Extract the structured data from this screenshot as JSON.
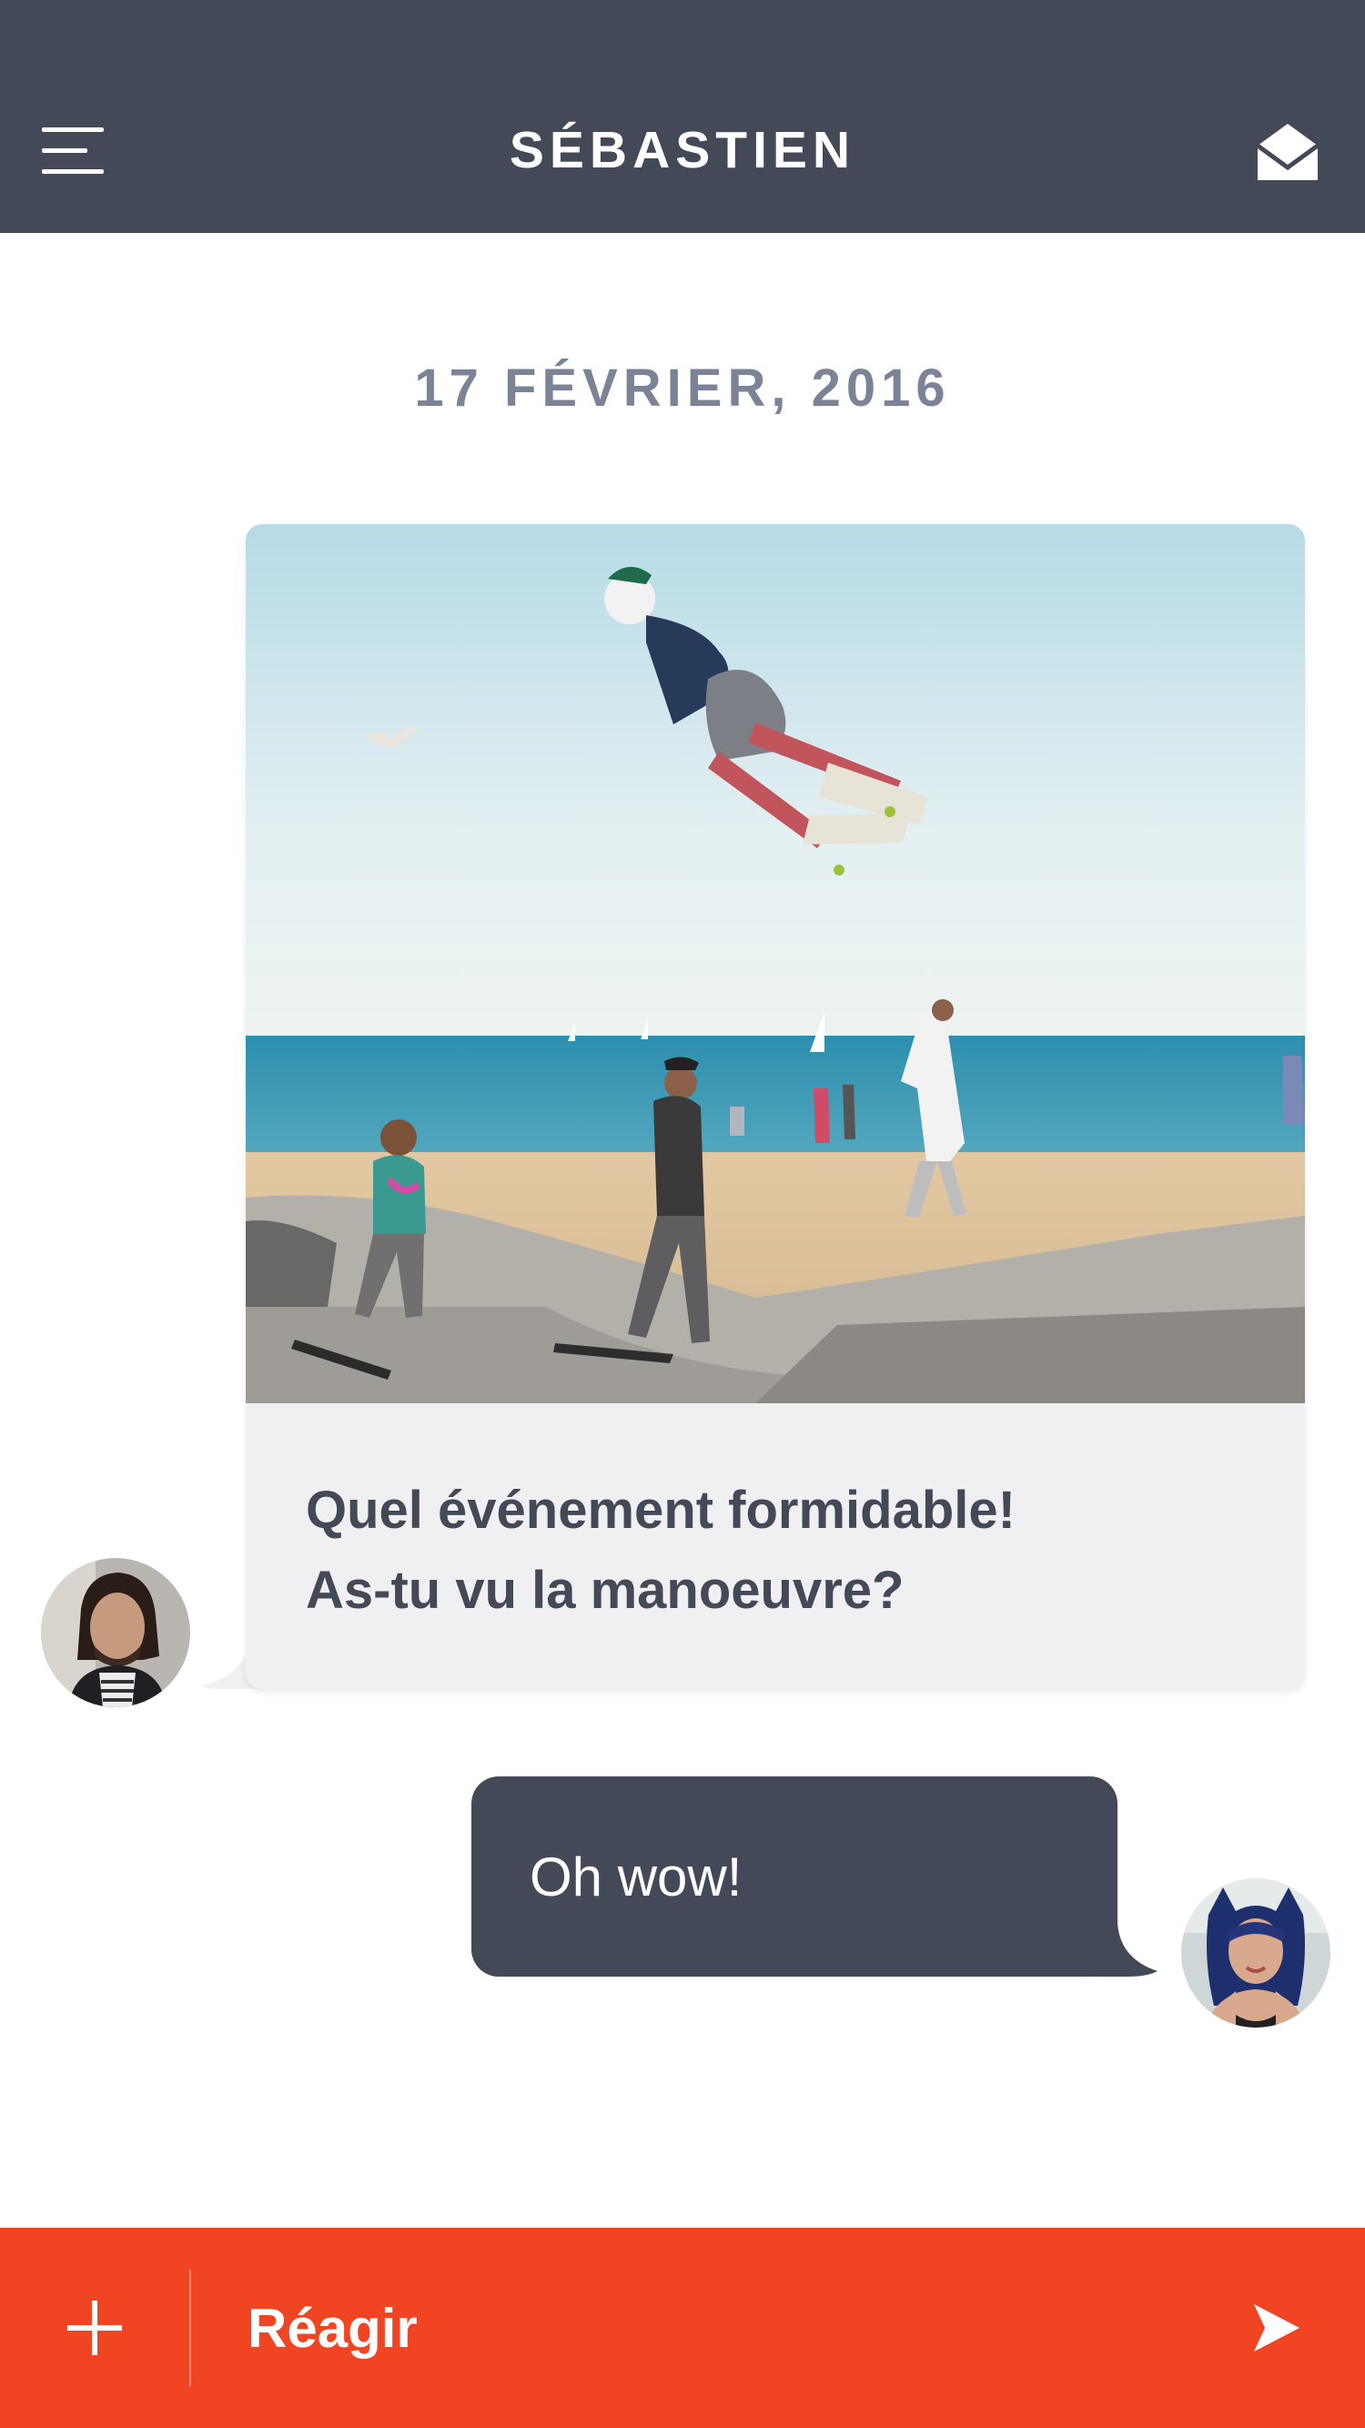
{
  "header": {
    "title": "SÉBASTIEN",
    "menu_icon": "hamburger-menu-icon",
    "mail_icon": "open-envelope-icon",
    "background": "#444957"
  },
  "conversation": {
    "date": "17 FÉVRIER, 2016",
    "messages": [
      {
        "sender": "Sébastien",
        "direction": "incoming",
        "has_photo": true,
        "photo_subject": "skateboarder jumping at beach skatepark",
        "lines": [
          "Quel événement formidable!",
          "As-tu vu la manoeuvre?"
        ],
        "bubble_color": "#f0f0f2"
      },
      {
        "sender": "me",
        "direction": "outgoing",
        "text": "Oh wow!",
        "bubble_color": "#444957"
      }
    ]
  },
  "composer": {
    "placeholder": "Réagir",
    "add_icon": "plus-icon",
    "send_icon": "paper-plane-send-icon",
    "background": "#f04423"
  }
}
